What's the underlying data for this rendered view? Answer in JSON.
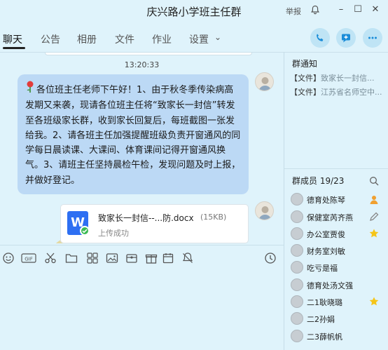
{
  "window": {
    "title": "庆兴路小学班主任群",
    "report_label": "举报",
    "bell_icon": "bell-icon",
    "minimize_glyph": "–",
    "maximize_glyph": "☐",
    "close_glyph": "✕"
  },
  "tabs": [
    {
      "label": "聊天"
    },
    {
      "label": "公告"
    },
    {
      "label": "相册"
    },
    {
      "label": "文件"
    },
    {
      "label": "作业"
    },
    {
      "label": "设置"
    }
  ],
  "settings_chevron": "⌄",
  "header_actions": [
    "phone-icon",
    "chat-add-icon",
    "more-icon"
  ],
  "chat": {
    "timestamp": "13:20:33",
    "message_text": "各位班主任老师下午好！1、由于秋冬季传染病高发期又来袭，现请各位班主任将“致家长一封信”转发至各班级家长群，收到家长回复后，每班截图一张发给我。2、请各班主任加强提醒班级负责开窗通风的同学每日晨读课、大课间、体育课间记得开窗通风换气。3、请班主任坚持晨检午检，发现问题及时上报，并做好登记。",
    "file": {
      "icon_letter": "W",
      "name": "致家长一封信--...防.docx",
      "size": "(15KB)",
      "status": "上传成功"
    }
  },
  "toolbar_icons": [
    "emoji-icon",
    "gif-icon",
    "scissors-icon",
    "folder-icon",
    "screenshot-icon",
    "image-icon",
    "red-packet-icon",
    "gift-icon",
    "calendar-icon",
    "video-icon",
    "bell-off-icon",
    "history-icon"
  ],
  "notices": {
    "title": "群通知",
    "items": [
      {
        "tag": "【文件】",
        "text": "致家长一封信..."
      },
      {
        "tag": "【文件】",
        "text": "江苏省名师空中..."
      }
    ]
  },
  "members": {
    "title": "群成员 19/23",
    "list": [
      {
        "name": "德育处陈琴",
        "badge": "owner-icon",
        "badge_color": "#f0a030"
      },
      {
        "name": "保健室芮齐燕",
        "badge": "edit-icon",
        "badge_color": "#888888"
      },
      {
        "name": "办公室贾俊",
        "badge": "star-icon",
        "badge_color": "#f5c518"
      },
      {
        "name": "财务室刘敏",
        "badge": "",
        "badge_color": ""
      },
      {
        "name": "吃亏是福",
        "badge": "",
        "badge_color": ""
      },
      {
        "name": "德育处汤文强",
        "badge": "",
        "badge_color": ""
      },
      {
        "name": "二1耿晓璐",
        "badge": "star-icon",
        "badge_color": "#f5c518"
      },
      {
        "name": "二2孙娟",
        "badge": "",
        "badge_color": ""
      },
      {
        "name": "二3薛帆帆",
        "badge": "",
        "badge_color": ""
      }
    ]
  },
  "colors": {
    "background": "#dff3fb",
    "bubble": "#bcd9f5",
    "accent": "#1a8cd8"
  }
}
